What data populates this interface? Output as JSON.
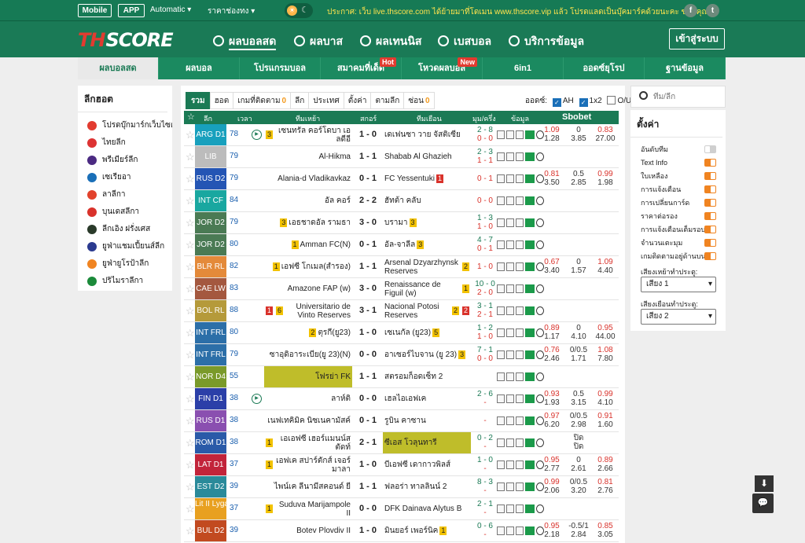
{
  "topbar": {
    "mobile": "Mobile",
    "app": "APP",
    "automatic": "Automatic",
    "price": "ราคาช่องทง",
    "notice": "ประกาศ: เว็บ live.thscore.com ได้ย้ายมาที่โดเมน www.thscore.vip แล้ว โปรดแลดเป็นบุ๊คมาร์คด้วยนะคะ ขอบคุณค่ะ",
    "social": [
      "f",
      "t"
    ]
  },
  "header": {
    "logo_a": "TH",
    "logo_b": "SCORE",
    "nav": [
      "ผลบอลสด",
      "ผลบาส",
      "ผลเทนนิส",
      "เบสบอล",
      "บริการข้อมูล"
    ],
    "login": "เข้าสู่ระบบ"
  },
  "subnav": [
    {
      "label": "ผลบอลสด",
      "badge": ""
    },
    {
      "label": "ผลบอล",
      "badge": ""
    },
    {
      "label": "โปรแกรมบอล",
      "badge": ""
    },
    {
      "label": "สมาคมที่เด็ด",
      "badge": "Hot"
    },
    {
      "label": "โหวดผลบอล",
      "badge": "New"
    },
    {
      "label": "6in1",
      "badge": ""
    },
    {
      "label": "ออดซ์ยุโรป",
      "badge": ""
    },
    {
      "label": "ฐานข้อมูล",
      "badge": ""
    }
  ],
  "left": {
    "title": "ลีกฮอต",
    "leagues": [
      {
        "name": "โปรดบุ๊กมาร์กเว็บไซต์",
        "color": "#e23b30"
      },
      {
        "name": "ไทยลีก",
        "color": "#d33"
      },
      {
        "name": "พรีเมียร์ลีก",
        "color": "#4b2a82"
      },
      {
        "name": "เซเรียอา",
        "color": "#1a6fb8"
      },
      {
        "name": "ลาลีกา",
        "color": "#e2422c"
      },
      {
        "name": "บุนเดสลีกา",
        "color": "#d9322b"
      },
      {
        "name": "ลีกเอิง ฝรั่งเศส",
        "color": "#2a3a2a"
      },
      {
        "name": "ยูฟ่าแชมเปี้ยนส์ลีก",
        "color": "#2b3a8f"
      },
      {
        "name": "ยูฟ่ายูโรป้าลีก",
        "color": "#f08421"
      },
      {
        "name": "ปริไมราลีกา",
        "color": "#1b8a3a"
      }
    ]
  },
  "tabs": [
    {
      "label": "รวม",
      "count": ""
    },
    {
      "label": "ฮอต",
      "count": ""
    },
    {
      "label": "เกมที่ติดตาม",
      "count": "0"
    },
    {
      "label": "ลีก",
      "count": ""
    },
    {
      "label": "ประเทศ",
      "count": ""
    },
    {
      "label": "ตั้งค่า",
      "count": ""
    },
    {
      "label": "ตามลีก",
      "count": ""
    },
    {
      "label": "ซ่อน",
      "count": "0"
    }
  ],
  "odds_bar": {
    "label": "ออดซ์:",
    "ah": "AH",
    "x12": "1x2",
    "ou": "O/U"
  },
  "table_head": {
    "league": "ลีก",
    "time": "เวลา",
    "home": "ทีมเหย้า",
    "score": "สกอร์",
    "away": "ทีมเยือน",
    "ht": "มุม/ครึ่ง",
    "info": "ข้อมูล",
    "sbobet": "Sbobet"
  },
  "matches": [
    {
      "league": "ARG D1",
      "color": "#18a0bd",
      "min": "78",
      "play": true,
      "home": "เซนทรัล คอร์โดบา เอลดีอี",
      "hy": "3",
      "hr": "",
      "score": "1 - 0",
      "away": "เดเฟนซา วาย จัสติเซีย",
      "ay": "",
      "ar": "",
      "ht1": "2 - 8",
      "ht2": "0 - 0",
      "o1": [
        "1.09",
        "0",
        "0.83"
      ],
      "o2": [
        "1.28",
        "3.85",
        "27.00"
      ],
      "hl": ""
    },
    {
      "league": "LIB",
      "color": "#bcbcbc",
      "min": "79",
      "play": false,
      "home": "Al-Hikma",
      "hy": "",
      "hr": "",
      "score": "1 - 1",
      "away": "Shabab Al Ghazieh",
      "ay": "",
      "ar": "",
      "ht1": "2 - 3",
      "ht2": "1 - 1",
      "o1": [],
      "o2": [],
      "hl": ""
    },
    {
      "league": "RUS D2",
      "color": "#2455b4",
      "min": "79",
      "play": false,
      "home": "Alania-d Vladikavkaz",
      "hy": "",
      "hr": "",
      "score": "0 - 1",
      "away": "FC Yessentuki",
      "ay": "",
      "ar": "1",
      "ht1": "0 - 1",
      "ht2": "",
      "o1": [
        "0.81",
        "0.5",
        "0.99"
      ],
      "o2": [
        "3.50",
        "2.85",
        "1.98"
      ],
      "hl": ""
    },
    {
      "league": "INT CF",
      "color": "#19a7a0",
      "min": "84",
      "play": false,
      "home": "อัล คอร์",
      "hy": "",
      "hr": "",
      "score": "2 - 2",
      "away": "ฮัทต้า คลับ",
      "ay": "",
      "ar": "",
      "ht1": "0 - 0",
      "ht2": "",
      "o1": [],
      "o2": [],
      "hl": ""
    },
    {
      "league": "JOR D2",
      "color": "#4a7a54",
      "min": "79",
      "play": false,
      "home": "เอธชาดอัล รามธา",
      "hy": "3",
      "hr": "",
      "score": "3 - 0",
      "away": "บรามา",
      "ay": "3",
      "ar": "",
      "ht1": "1 - 3",
      "ht2": "1 - 0",
      "o1": [],
      "o2": [],
      "hl": ""
    },
    {
      "league": "JOR D2",
      "color": "#4a7a54",
      "min": "80",
      "play": false,
      "home": "Amman FC(N)",
      "hy": "1",
      "hr": "",
      "score": "0 - 1",
      "away": "อัล-จาลีล",
      "ay": "3",
      "ar": "",
      "ht1": "4 - 7",
      "ht2": "0 - 1",
      "o1": [],
      "o2": [],
      "hl": ""
    },
    {
      "league": "BLR RL",
      "color": "#e48a3a",
      "min": "82",
      "play": false,
      "home": "เอฟซี โกเมล(สำรอง)",
      "hy": "1",
      "hr": "",
      "score": "1 - 1",
      "away": "Arsenal Dzyarzhynsk Reserves",
      "ay": "2",
      "ar": "",
      "ht1": "1 - 0",
      "ht2": "",
      "o1": [
        "0.67",
        "0",
        "1.09"
      ],
      "o2": [
        "3.40",
        "1.57",
        "4.40"
      ],
      "hl": ""
    },
    {
      "league": "CAE LW",
      "color": "#a4583f",
      "min": "83",
      "play": false,
      "home": "Amazone FAP (w)",
      "hy": "",
      "hr": "",
      "score": "3 - 0",
      "away": "Renaissance de Figuil (w)",
      "ay": "1",
      "ar": "",
      "ht1": "10 - 0",
      "ht2": "2 - 0",
      "o1": [],
      "o2": [],
      "hl": ""
    },
    {
      "league": "BOL RL",
      "color": "#b59a3a",
      "min": "88",
      "play": false,
      "home": "Universitario de Vinto Reserves",
      "hy": "6",
      "hr": "1",
      "score": "3 - 1",
      "away": "Nacional Potosi Reserves",
      "ay": "2",
      "ar": "2",
      "ht1": "3 - 1",
      "ht2": "2 - 1",
      "o1": [],
      "o2": [],
      "hl": ""
    },
    {
      "league": "INT FRL",
      "color": "#2c6fa8",
      "min": "80",
      "play": false,
      "home": "ตุรกี(ยู23)",
      "hy": "2",
      "hr": "",
      "score": "1 - 0",
      "away": "เซเนกัล (ยู23)",
      "ay": "5",
      "ar": "",
      "ht1": "1 - 2",
      "ht2": "1 - 0",
      "o1": [
        "0.89",
        "0",
        "0.95"
      ],
      "o2": [
        "1.17",
        "4.10",
        "44.00"
      ],
      "hl": ""
    },
    {
      "league": "INT FRL",
      "color": "#2c6fa8",
      "min": "79",
      "play": false,
      "home": "ซาอุดิอาระเบีย(ยู 23)(N)",
      "hy": "",
      "hr": "",
      "score": "0 - 0",
      "away": "อาเซอร์ไบจาน (ยู 23)",
      "ay": "3",
      "ar": "",
      "ht1": "7 - 1",
      "ht2": "0 - 0",
      "o1": [
        "0.76",
        "0/0.5",
        "1.08"
      ],
      "o2": [
        "2.46",
        "1.71",
        "7.80"
      ],
      "hl": ""
    },
    {
      "league": "NOR D4",
      "color": "#7a9a2a",
      "min": "55",
      "play": false,
      "home": "โฟรย่า FK",
      "hy": "",
      "hr": "",
      "score": "1 - 1",
      "away": "สตรอมก็อดเซ็ท 2",
      "ay": "",
      "ar": "",
      "ht1": "",
      "ht2": "",
      "o1": [],
      "o2": [],
      "hl": "home"
    },
    {
      "league": "FIN D1",
      "color": "#2b3fa8",
      "min": "38",
      "play": true,
      "home": "ลาห์ติ",
      "hy": "",
      "hr": "",
      "score": "0 - 0",
      "away": "เฮลไอเอฟเค",
      "ay": "",
      "ar": "",
      "ht1": "2 - 6",
      "ht2": "-",
      "o1": [
        "0.93",
        "0.5",
        "0.99"
      ],
      "o2": [
        "1.93",
        "3.15",
        "4.10"
      ],
      "hl": ""
    },
    {
      "league": "RUS D1",
      "color": "#8a4fb0",
      "min": "38",
      "play": false,
      "home": "เนฟเทคิมิค นิซเนคามัสค์",
      "hy": "",
      "hr": "",
      "score": "0 - 1",
      "away": "รูบิน คาซาน",
      "ay": "",
      "ar": "",
      "ht1": "-",
      "ht2": "",
      "o1": [
        "0.97",
        "0/0.5",
        "0.91"
      ],
      "o2": [
        "6.20",
        "2.98",
        "1.60"
      ],
      "hl": ""
    },
    {
      "league": "ROM D1",
      "color": "#2a5aa8",
      "min": "38",
      "play": false,
      "home": "เอเอฟซี เฮอร์แมนน์สตัดท์",
      "hy": "1",
      "hr": "",
      "score": "2 - 1",
      "away": "ซีเอส โวลุนทารี",
      "ay": "",
      "ar": "",
      "ht1": "0 - 2",
      "ht2": "-",
      "o1": [
        "",
        "ปิด",
        ""
      ],
      "o2": [
        "",
        "ปิด",
        ""
      ],
      "hl": "away"
    },
    {
      "league": "LAT D1",
      "color": "#c2243a",
      "min": "37",
      "play": false,
      "home": "เอฟเค สปาร์ตักส์ เจอร์มาลา",
      "hy": "1",
      "hr": "",
      "score": "1 - 0",
      "away": "บีเอฟซี เดากาวพิลส์",
      "ay": "",
      "ar": "",
      "ht1": "1 - 0",
      "ht2": "-",
      "o1": [
        "0.95",
        "0",
        "0.89"
      ],
      "o2": [
        "2.77",
        "2.61",
        "2.66"
      ],
      "hl": ""
    },
    {
      "league": "EST D2",
      "color": "#2a8a9a",
      "min": "39",
      "play": false,
      "home": "ไพน์เค ลีนามีสคอนด์ ยี",
      "hy": "",
      "hr": "",
      "score": "1 - 1",
      "away": "ฟลอร่า ทาลลินน์ 2",
      "ay": "",
      "ar": "",
      "ht1": "8 - 3",
      "ht2": "-",
      "o1": [
        "0.99",
        "0/0.5",
        "0.81"
      ],
      "o2": [
        "2.06",
        "3.20",
        "2.76"
      ],
      "hl": ""
    },
    {
      "league": "Lit II Lyga",
      "color": "#e8a020",
      "min": "37",
      "play": false,
      "home": "Suduva Marijampole II",
      "hy": "1",
      "hr": "",
      "score": "0 - 0",
      "away": "DFK Dainava Alytus B",
      "ay": "",
      "ar": "",
      "ht1": "2 - 1",
      "ht2": "-",
      "o1": [],
      "o2": [],
      "hl": ""
    },
    {
      "league": "BUL D2",
      "color": "#c24a20",
      "min": "39",
      "play": false,
      "home": "Botev Plovdiv II",
      "hy": "",
      "hr": "",
      "score": "1 - 0",
      "away": "มินยอร์ เพอร์นิค",
      "ay": "1",
      "ar": "",
      "ht1": "0 - 6",
      "ht2": "-",
      "o1": [
        "0.95",
        "-0.5/1",
        "0.85"
      ],
      "o2": [
        "2.18",
        "2.84",
        "3.05"
      ],
      "hl": ""
    }
  ],
  "search": {
    "placeholder": "ทีม/ลีก"
  },
  "settings": {
    "title": "ตั้งค่า",
    "items": [
      {
        "label": "อันดับทีม",
        "on": false
      },
      {
        "label": "Text Info",
        "on": true
      },
      {
        "label": "ใบเหลือง",
        "on": true
      },
      {
        "label": "การแจ้งเตือน",
        "on": true
      },
      {
        "label": "การเปลี่ยนการ์ด",
        "on": true
      },
      {
        "label": "ราคาต่อรอง",
        "on": true
      },
      {
        "label": "การแจ้งเตือนเต็มรอบ",
        "on": true
      },
      {
        "label": "จำนวนเตะมุม",
        "on": true
      },
      {
        "label": "เกมติดตามอยู่ด้านบน",
        "on": true
      }
    ],
    "home_sound_label": "เสียงเหย้าทำประตู:",
    "home_sound": "เสียง 1",
    "away_sound_label": "เสียงเยือนทำประตู:",
    "away_sound": "เสียง 2"
  },
  "float": {
    "down": "⬇",
    "chat": "💬"
  }
}
